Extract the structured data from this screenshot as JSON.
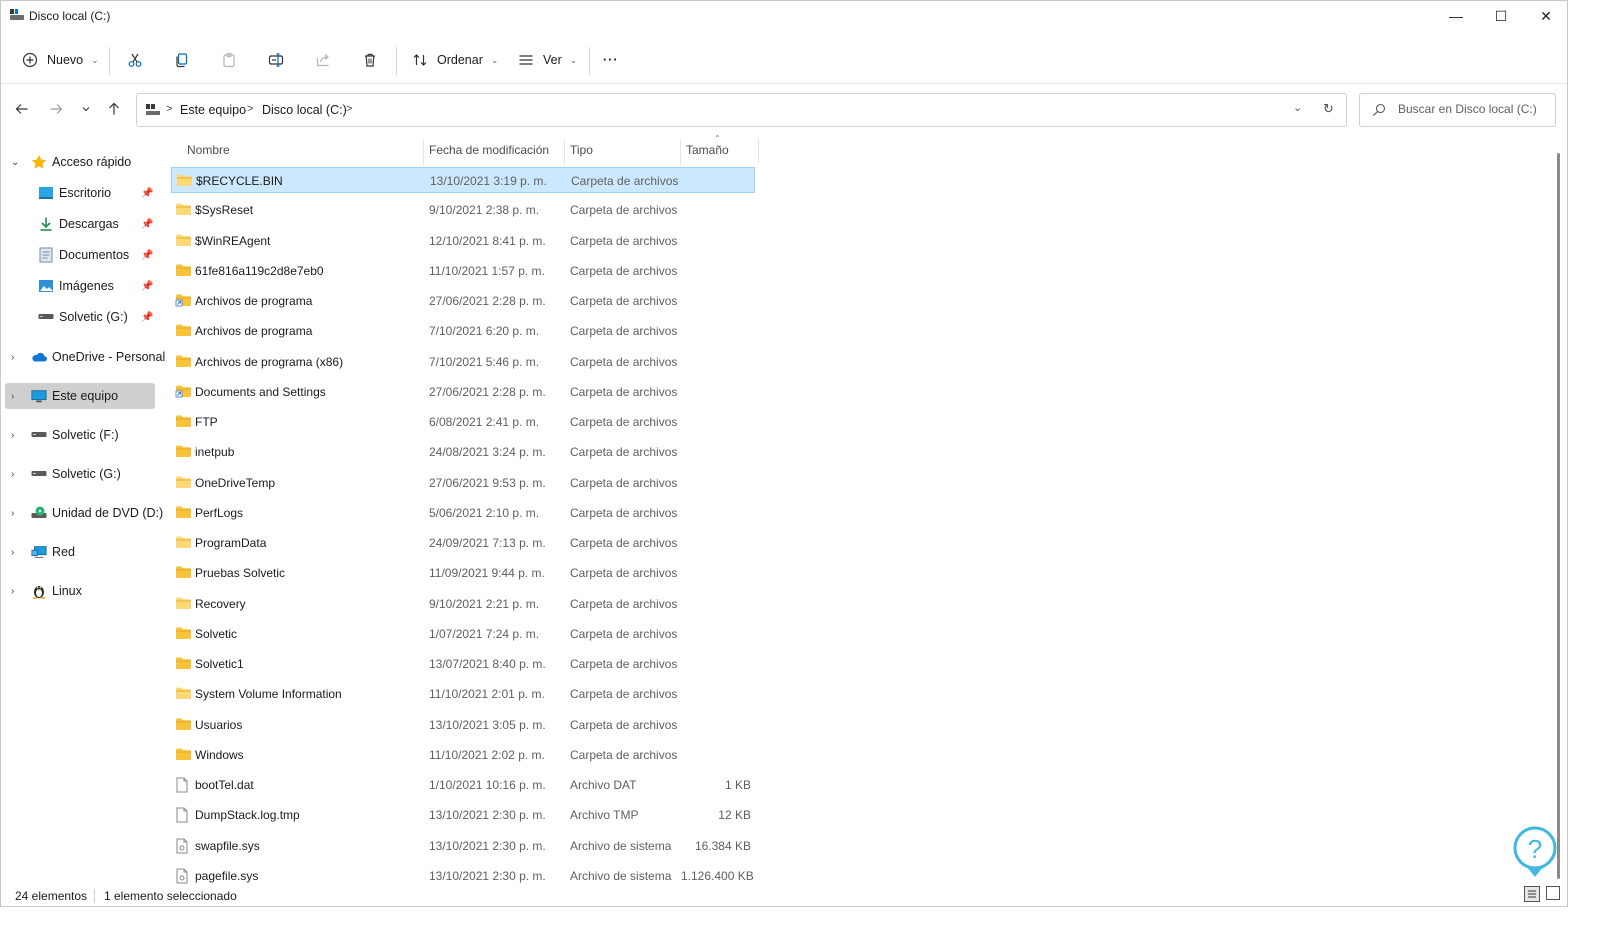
{
  "window": {
    "title": "Disco local (C:)",
    "controls": {
      "minimize": "—",
      "maximize": "☐",
      "close": "✕"
    }
  },
  "toolbar": {
    "new_label": "Nuevo",
    "sort_label": "Ordenar",
    "view_label": "Ver",
    "more_label": "···"
  },
  "address": {
    "crumbs": [
      "Este equipo",
      "Disco local (C:)"
    ],
    "separator": ">"
  },
  "search": {
    "placeholder": "Buscar en Disco local (C:)"
  },
  "sidebar": {
    "items": [
      {
        "label": "Acceso rápido",
        "icon": "star-icon"
      },
      {
        "label": "Escritorio",
        "icon": "desktop-icon",
        "pinned": true
      },
      {
        "label": "Descargas",
        "icon": "download-icon",
        "pinned": true
      },
      {
        "label": "Documentos",
        "icon": "document-icon",
        "pinned": true
      },
      {
        "label": "Imágenes",
        "icon": "image-icon",
        "pinned": true
      },
      {
        "label": "Solvetic (G:)",
        "icon": "drive-icon",
        "pinned": true
      },
      {
        "label": "OneDrive - Personal",
        "icon": "cloud-icon"
      },
      {
        "label": "Este equipo",
        "icon": "computer-icon",
        "selected": true
      },
      {
        "label": "Solvetic (F:)",
        "icon": "drive-icon"
      },
      {
        "label": "Solvetic (G:)",
        "icon": "drive-icon"
      },
      {
        "label": "Unidad de DVD (D:)",
        "icon": "dvd-icon"
      },
      {
        "label": "Red",
        "icon": "network-icon"
      },
      {
        "label": "Linux",
        "icon": "linux-icon"
      }
    ]
  },
  "columns": {
    "name": "Nombre",
    "date": "Fecha de modificación",
    "type": "Tipo",
    "size": "Tamaño"
  },
  "files": [
    {
      "name": "$RECYCLE.BIN",
      "date": "13/10/2021 3:19 p. m.",
      "type": "Carpeta de archivos",
      "size": "",
      "icon": "folder-light",
      "selected": true
    },
    {
      "name": "$SysReset",
      "date": "9/10/2021 2:38 p. m.",
      "type": "Carpeta de archivos",
      "size": "",
      "icon": "folder-light"
    },
    {
      "name": "$WinREAgent",
      "date": "12/10/2021 8:41 p. m.",
      "type": "Carpeta de archivos",
      "size": "",
      "icon": "folder-light"
    },
    {
      "name": "61fe816a119c2d8e7eb0",
      "date": "11/10/2021 1:57 p. m.",
      "type": "Carpeta de archivos",
      "size": "",
      "icon": "folder"
    },
    {
      "name": "Archivos de programa",
      "date": "27/06/2021 2:28 p. m.",
      "type": "Carpeta de archivos",
      "size": "",
      "icon": "folder-shortcut"
    },
    {
      "name": "Archivos de programa",
      "date": "7/10/2021 6:20 p. m.",
      "type": "Carpeta de archivos",
      "size": "",
      "icon": "folder"
    },
    {
      "name": "Archivos de programa (x86)",
      "date": "7/10/2021 5:46 p. m.",
      "type": "Carpeta de archivos",
      "size": "",
      "icon": "folder"
    },
    {
      "name": "Documents and Settings",
      "date": "27/06/2021 2:28 p. m.",
      "type": "Carpeta de archivos",
      "size": "",
      "icon": "folder-shortcut"
    },
    {
      "name": "FTP",
      "date": "6/08/2021 2:41 p. m.",
      "type": "Carpeta de archivos",
      "size": "",
      "icon": "folder"
    },
    {
      "name": "inetpub",
      "date": "24/08/2021 3:24 p. m.",
      "type": "Carpeta de archivos",
      "size": "",
      "icon": "folder"
    },
    {
      "name": "OneDriveTemp",
      "date": "27/06/2021 9:53 p. m.",
      "type": "Carpeta de archivos",
      "size": "",
      "icon": "folder-light"
    },
    {
      "name": "PerfLogs",
      "date": "5/06/2021 2:10 p. m.",
      "type": "Carpeta de archivos",
      "size": "",
      "icon": "folder"
    },
    {
      "name": "ProgramData",
      "date": "24/09/2021 7:13 p. m.",
      "type": "Carpeta de archivos",
      "size": "",
      "icon": "folder-light"
    },
    {
      "name": "Pruebas Solvetic",
      "date": "11/09/2021 9:44 p. m.",
      "type": "Carpeta de archivos",
      "size": "",
      "icon": "folder"
    },
    {
      "name": "Recovery",
      "date": "9/10/2021 2:21 p. m.",
      "type": "Carpeta de archivos",
      "size": "",
      "icon": "folder-light"
    },
    {
      "name": "Solvetic",
      "date": "1/07/2021 7:24 p. m.",
      "type": "Carpeta de archivos",
      "size": "",
      "icon": "folder"
    },
    {
      "name": "Solvetic1",
      "date": "13/07/2021 8:40 p. m.",
      "type": "Carpeta de archivos",
      "size": "",
      "icon": "folder"
    },
    {
      "name": "System Volume Information",
      "date": "11/10/2021 2:01 p. m.",
      "type": "Carpeta de archivos",
      "size": "",
      "icon": "folder-light"
    },
    {
      "name": "Usuarios",
      "date": "13/10/2021 3:05 p. m.",
      "type": "Carpeta de archivos",
      "size": "",
      "icon": "folder"
    },
    {
      "name": "Windows",
      "date": "11/10/2021 2:02 p. m.",
      "type": "Carpeta de archivos",
      "size": "",
      "icon": "folder"
    },
    {
      "name": "bootTel.dat",
      "date": "1/10/2021 10:16 p. m.",
      "type": "Archivo DAT",
      "size": "1 KB",
      "icon": "file"
    },
    {
      "name": "DumpStack.log.tmp",
      "date": "13/10/2021 2:30 p. m.",
      "type": "Archivo TMP",
      "size": "12 KB",
      "icon": "file"
    },
    {
      "name": "swapfile.sys",
      "date": "13/10/2021 2:30 p. m.",
      "type": "Archivo de sistema",
      "size": "16.384 KB",
      "icon": "system-file"
    },
    {
      "name": "pagefile.sys",
      "date": "13/10/2021 2:30 p. m.",
      "type": "Archivo de sistema",
      "size": "1.126.400 KB",
      "icon": "system-file"
    }
  ],
  "status": {
    "count": "24 elementos",
    "selection": "1 elemento seleccionado"
  },
  "colors": {
    "selection_bg": "#cce8ff",
    "selection_border": "#99d1ff",
    "sidebar_selected": "#cfcfcf",
    "folder": "#f8c33a",
    "folder_light": "#fcd876",
    "accent_blue": "#0067c0"
  }
}
